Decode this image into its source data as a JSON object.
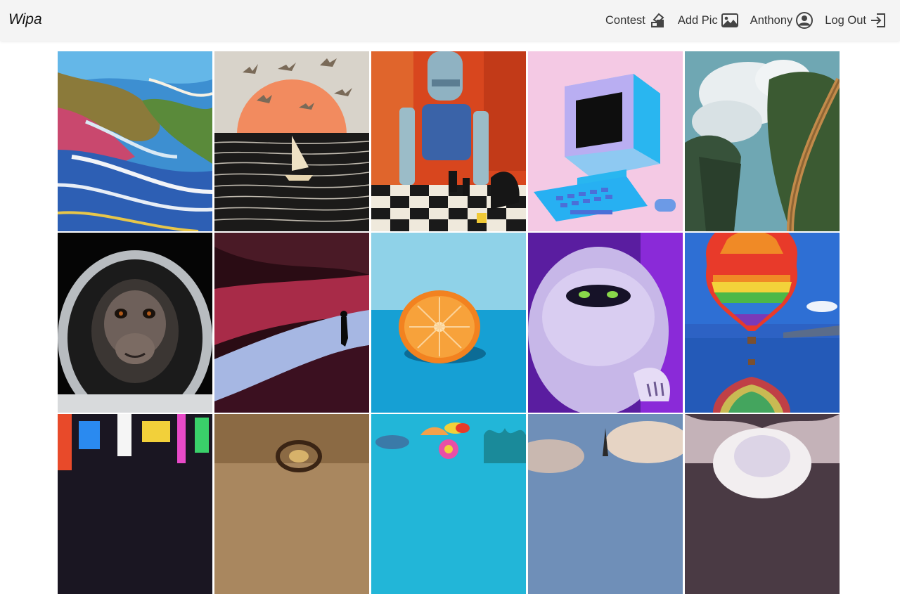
{
  "app": {
    "brand": "Wipa"
  },
  "nav": {
    "items": [
      {
        "label": "Contest",
        "icon": "contest-icon"
      },
      {
        "label": "Add Pic",
        "icon": "image-icon"
      },
      {
        "label": "Anthony",
        "icon": "user-icon"
      },
      {
        "label": "Log Out",
        "icon": "logout-icon"
      }
    ]
  },
  "gallery": {
    "images": [
      {
        "subject": "impressionist-coastal-painting"
      },
      {
        "subject": "sailboat-sunset-birds"
      },
      {
        "subject": "robot-playing-chess"
      },
      {
        "subject": "retro-computer-illustration"
      },
      {
        "subject": "cliffs-with-road-and-clouds"
      },
      {
        "subject": "monkey-astronaut"
      },
      {
        "subject": "figure-on-dunes"
      },
      {
        "subject": "orange-half-on-blue"
      },
      {
        "subject": "purple-furry-creature"
      },
      {
        "subject": "rainbow-hot-air-balloon"
      },
      {
        "subject": "neon-city-street"
      },
      {
        "subject": "brass-pocket-object"
      },
      {
        "subject": "underwater-reef-fish"
      },
      {
        "subject": "rocket-in-clouds"
      },
      {
        "subject": "white-fluffy-creature"
      }
    ]
  }
}
